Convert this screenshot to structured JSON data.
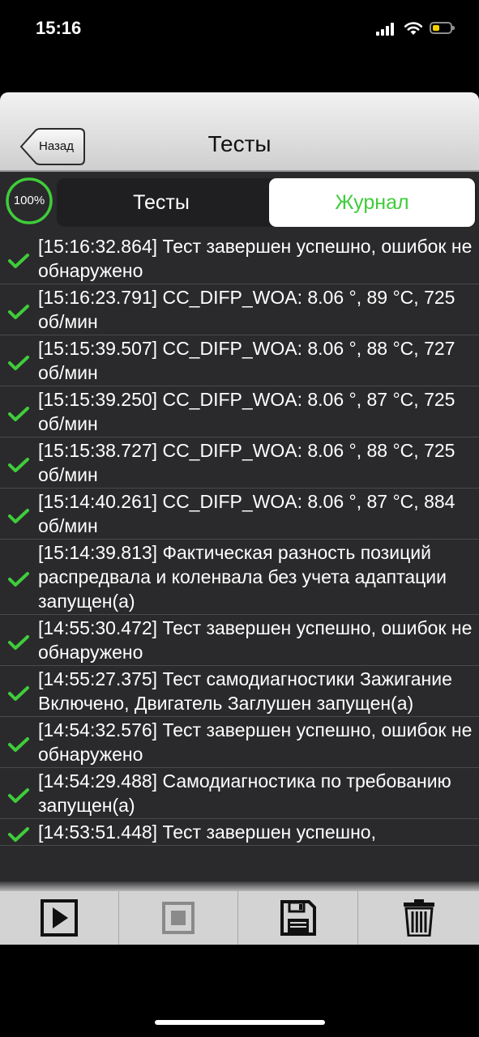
{
  "status_bar": {
    "time": "15:16"
  },
  "nav": {
    "back_label": "Назад",
    "title": "Тесты"
  },
  "progress": {
    "label": "100%",
    "value": 100
  },
  "segments": {
    "tests_label": "Тесты",
    "journal_label": "Журнал",
    "selected": "journal"
  },
  "log_entries": [
    {
      "text": "[15:16:32.864] Тест завершен успешно, ошибок не обнаружено",
      "status": "success"
    },
    {
      "text": "[15:16:23.791] CC_DIFP_WOA: 8.06 °, 89 °C, 725 об/мин",
      "status": "success"
    },
    {
      "text": "[15:15:39.507] CC_DIFP_WOA: 8.06 °, 88 °C, 727 об/мин",
      "status": "success"
    },
    {
      "text": "[15:15:39.250] CC_DIFP_WOA: 8.06 °, 87 °C, 725 об/мин",
      "status": "success"
    },
    {
      "text": "[15:15:38.727] CC_DIFP_WOA: 8.06 °, 88 °C, 725 об/мин",
      "status": "success"
    },
    {
      "text": "[15:14:40.261] CC_DIFP_WOA: 8.06 °, 87 °C, 884 об/мин",
      "status": "success"
    },
    {
      "text": "[15:14:39.813] Фактическая разность позиций распредвала и коленвала без учета адаптации запущен(а)",
      "status": "success"
    },
    {
      "text": "[14:55:30.472] Тест завершен успешно, ошибок не обнаружено",
      "status": "success"
    },
    {
      "text": "[14:55:27.375] Тест самодиагностики Зажигание Включено, Двигатель Заглушен запущен(а)",
      "status": "success"
    },
    {
      "text": "[14:54:32.576] Тест завершен успешно, ошибок не обнаружено",
      "status": "success"
    },
    {
      "text": "[14:54:29.488] Самодиагностика по требованию запущен(а)",
      "status": "success"
    },
    {
      "text": "[14:53:51.448] Тест завершен успешно,",
      "status": "success"
    }
  ],
  "toolbar": {
    "buttons": [
      {
        "icon": "play-icon"
      },
      {
        "icon": "stop-icon"
      },
      {
        "icon": "save-icon"
      },
      {
        "icon": "trash-icon"
      }
    ]
  },
  "colors": {
    "accent_green": "#3fcd3a",
    "battery": "#f5d100"
  }
}
